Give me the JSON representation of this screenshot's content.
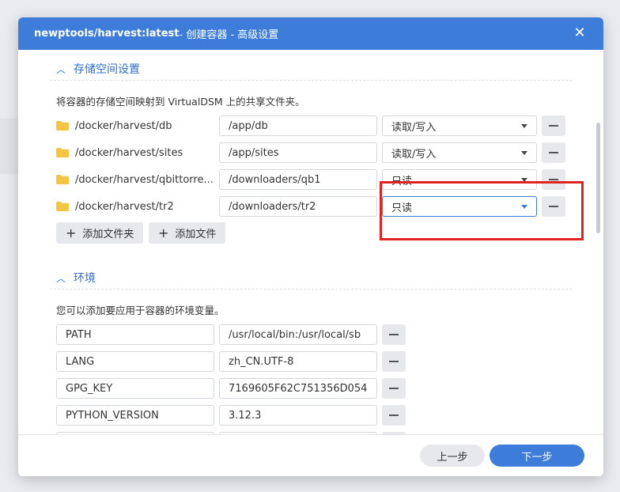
{
  "dialog": {
    "title_image": "newptools/harvest:latest",
    "title_rest": " - 创建容器 - 高级设置",
    "close_icon": "✕"
  },
  "storage": {
    "section_title": "存储空间设置",
    "description": "将容器的存储空间映射到 VirtualDSM 上的共享文件夹。",
    "rows": [
      {
        "folder": "/docker/harvest/db",
        "mount": "/app/db",
        "permission": "读取/写入"
      },
      {
        "folder": "/docker/harvest/sites",
        "mount": "/app/sites",
        "permission": "读取/写入"
      },
      {
        "folder": "/docker/harvest/qbittorre...",
        "mount": "/downloaders/qb1",
        "permission": "只读"
      },
      {
        "folder": "/docker/harvest/tr2",
        "mount": "/downloaders/tr2",
        "permission": "只读"
      }
    ],
    "add_folder_label": "添加文件夹",
    "add_file_label": "添加文件"
  },
  "env": {
    "section_title": "环境",
    "description": "您可以添加要应用于容器的环境变量。",
    "rows": [
      {
        "key": "PATH",
        "value": "/usr/local/bin:/usr/local/sb"
      },
      {
        "key": "LANG",
        "value": "zh_CN.UTF-8"
      },
      {
        "key": "GPG_KEY",
        "value": "7169605F62C751356D054"
      },
      {
        "key": "PYTHON_VERSION",
        "value": "3.12.3"
      }
    ]
  },
  "footer": {
    "prev_label": "上一步",
    "next_label": "下一步"
  },
  "colors": {
    "accent": "#3d7dd9",
    "highlight": "#e0231c"
  }
}
